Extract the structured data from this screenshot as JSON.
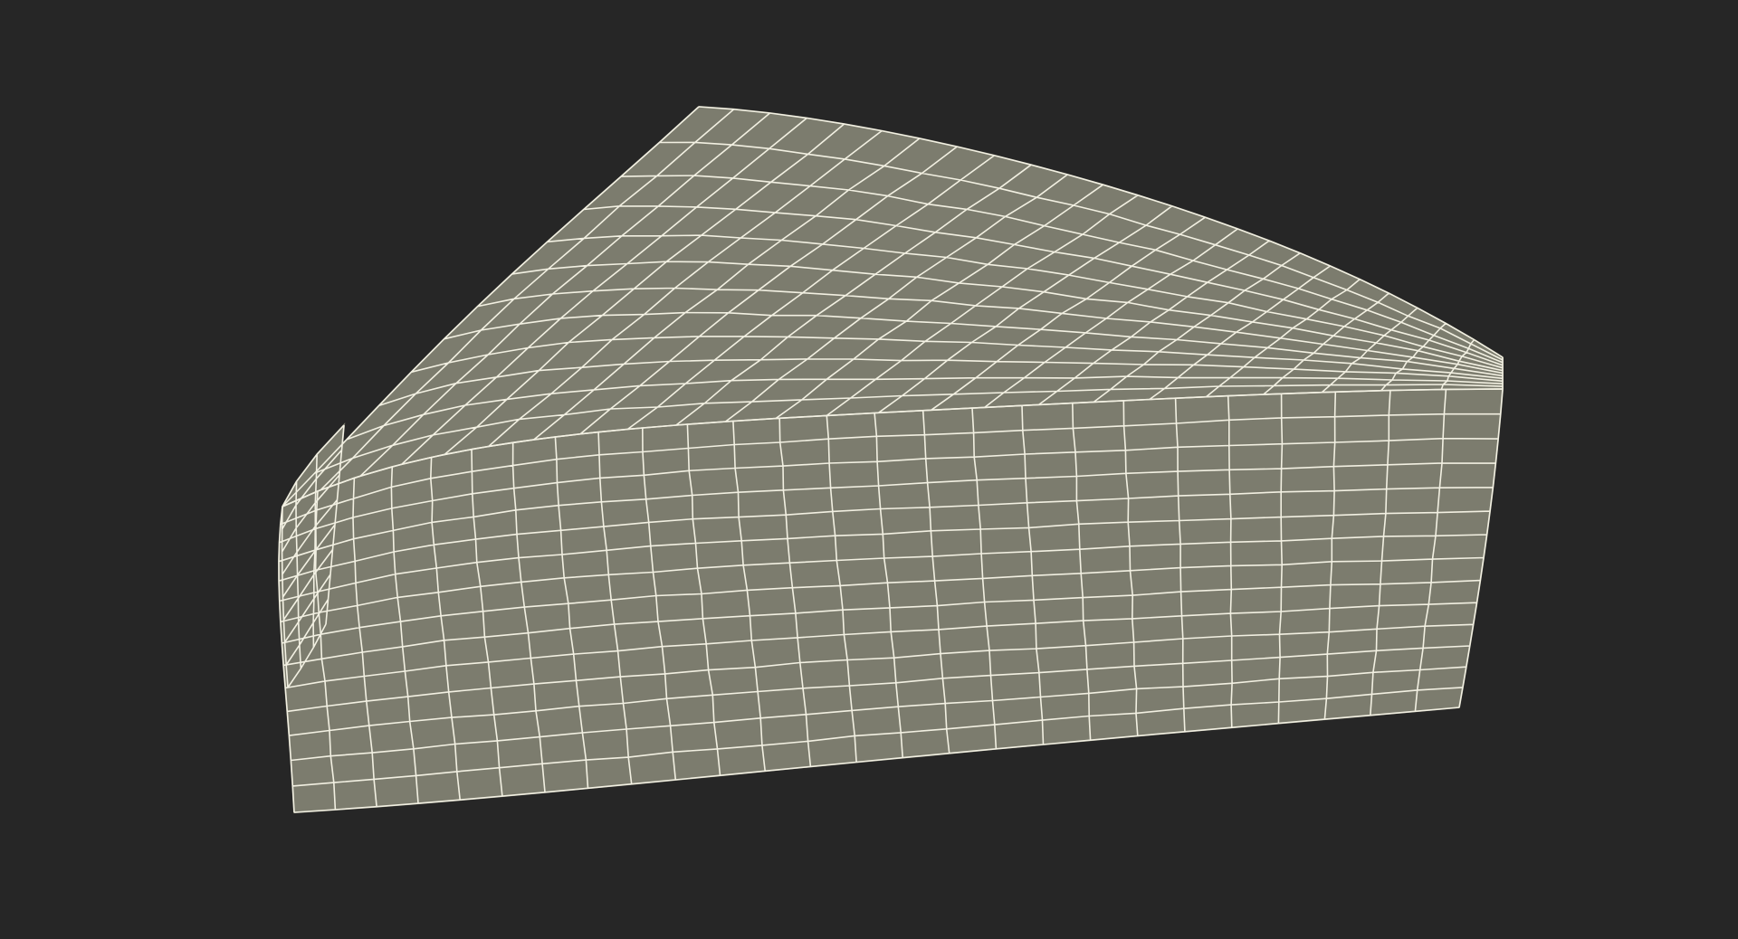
{
  "scene": {
    "subject": "wireframe-mesh",
    "background_color": "#262626",
    "surface_color": "#7c7c6e",
    "wire_color": "#f2f0e2"
  }
}
